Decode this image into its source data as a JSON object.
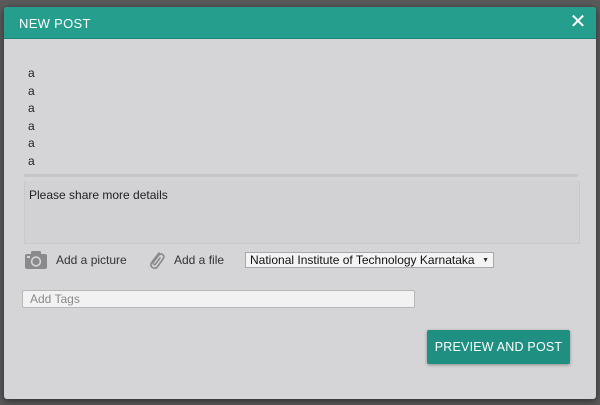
{
  "modal": {
    "title": "NEW POST",
    "close_glyph": "✕",
    "title_lines": [
      "a",
      "a",
      "a",
      "a",
      "a",
      "a"
    ],
    "details_placeholder": "Please share more details",
    "attachments": {
      "picture_label": "Add a picture",
      "picture_icon": "camera-icon",
      "file_label": "Add a file",
      "file_icon": "paperclip-icon"
    },
    "institution_select": {
      "selected": "National Institute of Technology Karnataka"
    },
    "tags": {
      "placeholder": "Add Tags",
      "value": ""
    },
    "submit_label": "PREVIEW AND POST"
  },
  "colors": {
    "header": "#259e8e",
    "button": "#1e8f81",
    "modal_bg": "#d5d5d7"
  }
}
